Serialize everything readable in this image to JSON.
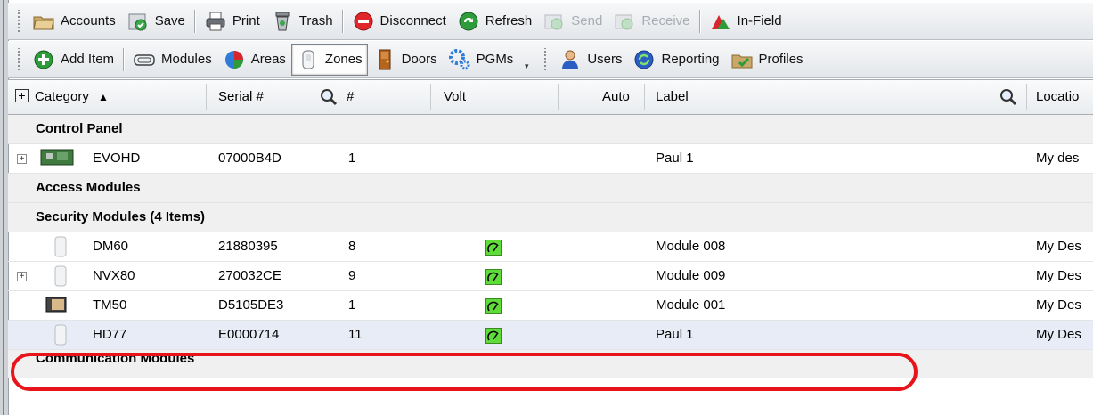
{
  "toolbar1": {
    "accounts": "Accounts",
    "save": "Save",
    "print": "Print",
    "trash": "Trash",
    "disconnect": "Disconnect",
    "refresh": "Refresh",
    "send": "Send",
    "receive": "Receive",
    "infield": "In-Field"
  },
  "toolbar2": {
    "add_item": "Add Item",
    "modules": "Modules",
    "areas": "Areas",
    "zones": "Zones",
    "doors": "Doors",
    "pgms": "PGMs",
    "users": "Users",
    "reporting": "Reporting",
    "profiles": "Profiles"
  },
  "columns": {
    "category": "Category",
    "sort_indicator": "▲",
    "serial": "Serial #",
    "num": "#",
    "volt": "Volt",
    "auto": "Auto",
    "label": "Label",
    "location": "Locatio"
  },
  "groups": {
    "control_panel": "Control Panel",
    "access_modules": "Access Modules",
    "security_modules": "Security Modules  (4 Items)",
    "communication_modules": "Communication Modules"
  },
  "rows": [
    {
      "name": "EVOHD",
      "serial": "07000B4D",
      "num": "1",
      "label": "Paul 1",
      "location": "My des"
    },
    {
      "name": "DM60",
      "serial": "21880395",
      "num": "8",
      "label": "Module 008",
      "location": "My Des"
    },
    {
      "name": "NVX80",
      "serial": "270032CE",
      "num": "9",
      "label": "Module 009",
      "location": "My Des"
    },
    {
      "name": "TM50",
      "serial": "D5105DE3",
      "num": "1",
      "label": "Module 001",
      "location": "My Des"
    },
    {
      "name": "HD77",
      "serial": "E0000714",
      "num": "11",
      "label": "Paul 1",
      "location": "My Des"
    }
  ],
  "colors": {
    "highlight": "#e8141c",
    "volt_ok": "#5fdc3a"
  }
}
